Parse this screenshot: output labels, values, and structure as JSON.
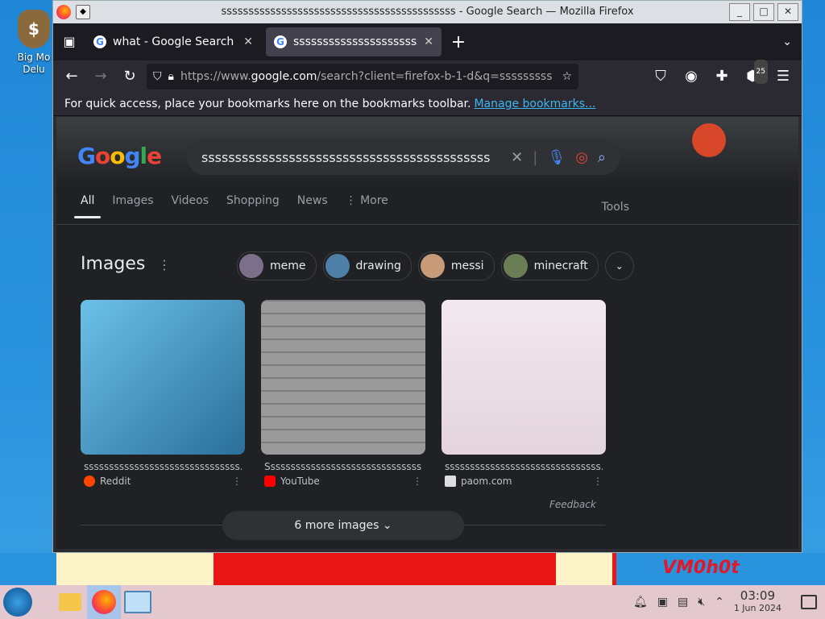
{
  "desktop": {
    "icon_label": "Big Mo\nDelu"
  },
  "wallpaper": {
    "watermark": "VM0h0t"
  },
  "window": {
    "title": "sssssssssssssssssssssssssssssssssssssssssss - Google Search — Mozilla Firefox",
    "controls": [
      "_",
      "□",
      "✕"
    ]
  },
  "tabs": [
    {
      "label": "what - Google Search",
      "active": false
    },
    {
      "label": "sssssssssssssssssssssssssssssssssssssssssss",
      "active": true
    }
  ],
  "nav": {
    "url_prefix": "https://www.",
    "url_host": "google.com",
    "url_rest": "/search?client=firefox-b-1-d&q=sssssssss",
    "badge_count": "25"
  },
  "bookmarks_bar": {
    "message": "For quick access, place your bookmarks here on the bookmarks toolbar.",
    "link": "Manage bookmarks..."
  },
  "google": {
    "logo_letters": [
      "G",
      "o",
      "o",
      "g",
      "l",
      "e"
    ],
    "query": "sssssssssssssssssssssssssssssssssssssssssss",
    "filters": [
      "All",
      "Images",
      "Videos",
      "Shopping",
      "News",
      "⋮ More"
    ],
    "tools": "Tools",
    "images_heading": "Images",
    "chips": [
      {
        "label": "meme",
        "color": "#7b6f8a"
      },
      {
        "label": "drawing",
        "color": "#4e7fa6"
      },
      {
        "label": "messi",
        "color": "#c79a78"
      },
      {
        "label": "minecraft",
        "color": "#6a7d54"
      }
    ],
    "results": [
      {
        "caption": "sssssssssssssssssssssssssssssss...",
        "source": "Reddit",
        "img_color": "#3b8fb5",
        "fav_color": "#ff4500"
      },
      {
        "caption": "Sssssssssssssssssssssssssssssss...",
        "source": "YouTube",
        "img_color": "#8a8a8a",
        "fav_color": "#ff0000"
      },
      {
        "caption": "sssssssssssssssssssssssssssssss...",
        "source": "paom.com",
        "img_color": "#efe6ea",
        "fav_color": "#dddddd"
      }
    ],
    "feedback": "Feedback",
    "more_images": "6 more images"
  },
  "taskbar": {
    "time": "03:09",
    "date": "1 Jun 2024"
  }
}
